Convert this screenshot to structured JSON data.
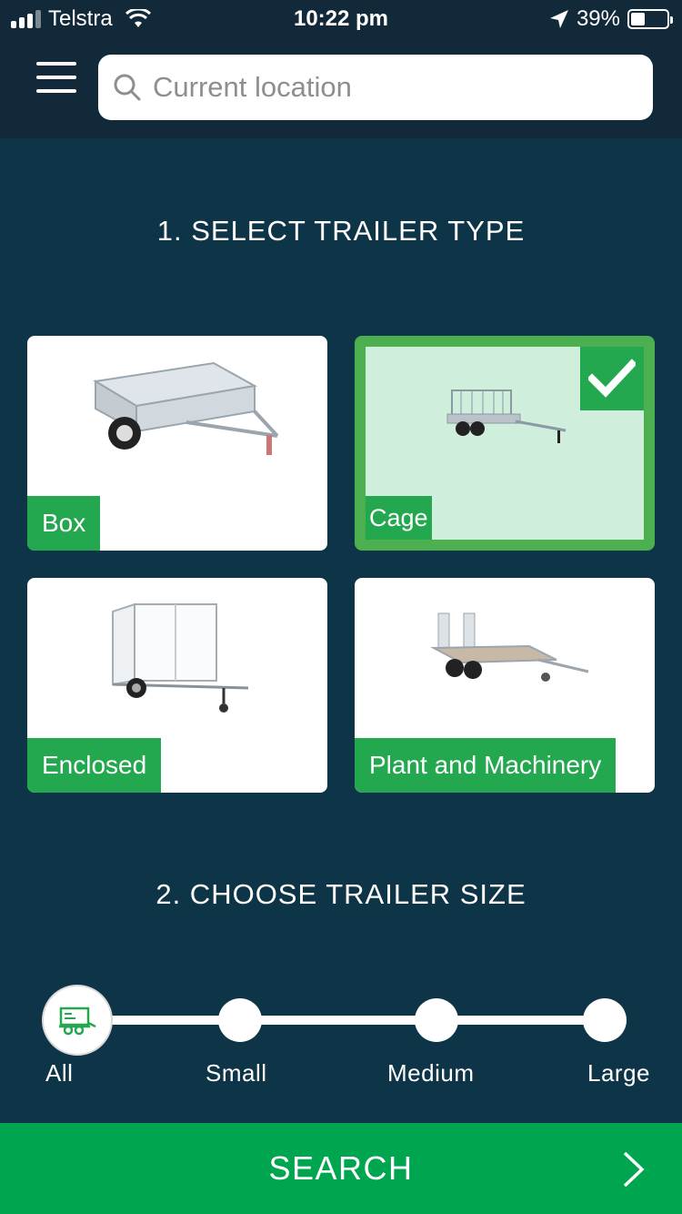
{
  "status_bar": {
    "carrier": "Telstra",
    "time": "10:22 pm",
    "battery": "39%"
  },
  "header": {
    "search_placeholder": "Current location"
  },
  "section1": {
    "title": "1. SELECT TRAILER TYPE"
  },
  "trailer_types": [
    {
      "label": "Box",
      "selected": false
    },
    {
      "label": "Cage",
      "selected": true
    },
    {
      "label": "Enclosed",
      "selected": false
    },
    {
      "label": "Plant and Machinery",
      "selected": false
    }
  ],
  "section2": {
    "title": "2. CHOOSE TRAILER SIZE"
  },
  "sizes": {
    "options": [
      "All",
      "Small",
      "Medium",
      "Large"
    ],
    "selected": "All"
  },
  "search_button": {
    "label": "SEARCH"
  },
  "colors": {
    "background": "#0e3547",
    "header": "#12293a",
    "accent_green": "#23a84f",
    "button_green": "#00a54f",
    "selected_card_tint": "#cfeedc"
  }
}
